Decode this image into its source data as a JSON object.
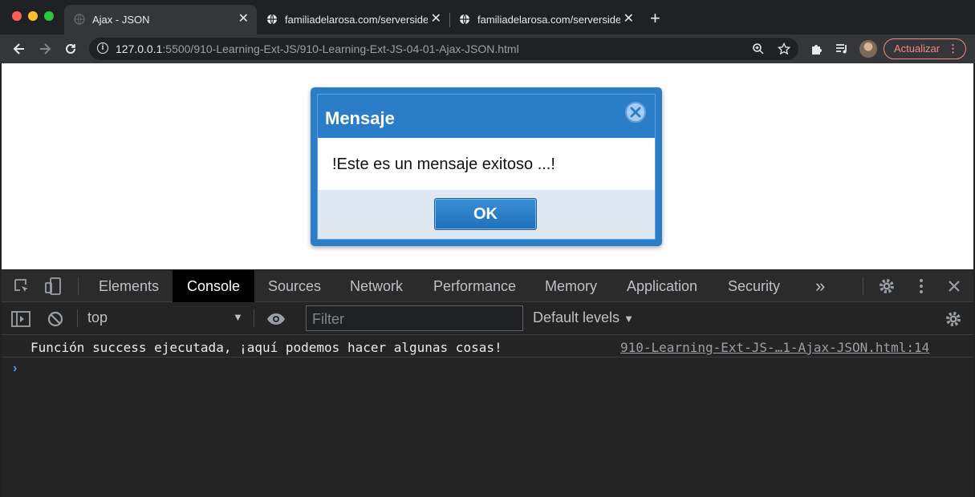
{
  "browser": {
    "tabs": [
      {
        "title": "Ajax - JSON",
        "active": true
      },
      {
        "title": "familiadelarosa.com/serverside",
        "active": false
      },
      {
        "title": "familiadelarosa.com/serverside",
        "active": false
      }
    ],
    "address": {
      "host": "127.0.0.1",
      "path": ":5500/910-Learning-Ext-JS/910-Learning-Ext-JS-04-01-Ajax-JSON.html"
    },
    "update_label": "Actualizar"
  },
  "dialog": {
    "title": "Mensaje",
    "message": "!Este es un mensaje exitoso ...!",
    "ok_label": "OK",
    "colors": {
      "header": "#2b7dc7",
      "footer": "#dfe8f1"
    }
  },
  "devtools": {
    "tabs": [
      "Elements",
      "Console",
      "Sources",
      "Network",
      "Performance",
      "Memory",
      "Application",
      "Security"
    ],
    "active_tab": "Console",
    "more_label": "»",
    "context": "top",
    "filter_placeholder": "Filter",
    "levels_label": "Default levels",
    "log": {
      "message": "Función success ejecutada, ¡aquí podemos hacer algunas cosas!",
      "source": "910-Learning-Ext-JS-…1-Ajax-JSON.html:14"
    },
    "prompt_symbol": "›"
  }
}
